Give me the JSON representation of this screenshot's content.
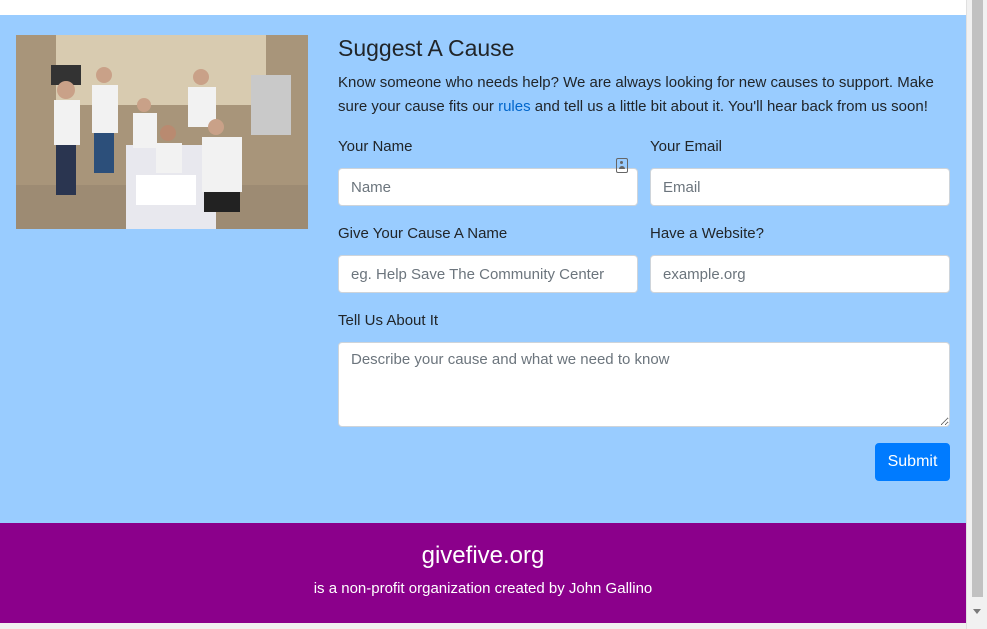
{
  "page": {
    "title": "Suggest A Cause",
    "intro_before": "Know someone who needs help? We are always looking for new causes to support. Make sure your cause fits our ",
    "intro_link": "rules",
    "intro_after": " and tell us a little bit about it. You'll hear back from us soon!"
  },
  "form": {
    "name_label": "Your Name",
    "name_placeholder": "Name",
    "email_label": "Your Email",
    "email_placeholder": "Email",
    "cause_label": "Give Your Cause A Name",
    "cause_placeholder": "eg. Help Save The Community Center",
    "website_label": "Have a Website?",
    "website_placeholder": "example.org",
    "about_label": "Tell Us About It",
    "about_placeholder": "Describe your cause and what we need to know",
    "submit_label": "Submit"
  },
  "footer": {
    "brand": "givefive.org",
    "tagline": "is a non-profit organization created by John Gallino"
  },
  "colors": {
    "main_bg": "#99ccff",
    "footer_bg": "#8b008b",
    "submit_bg": "#007bff",
    "link": "#0066cc"
  },
  "icons": [
    "contact-card-icon",
    "resize-handle-icon",
    "scroll-down-arrow-icon"
  ]
}
